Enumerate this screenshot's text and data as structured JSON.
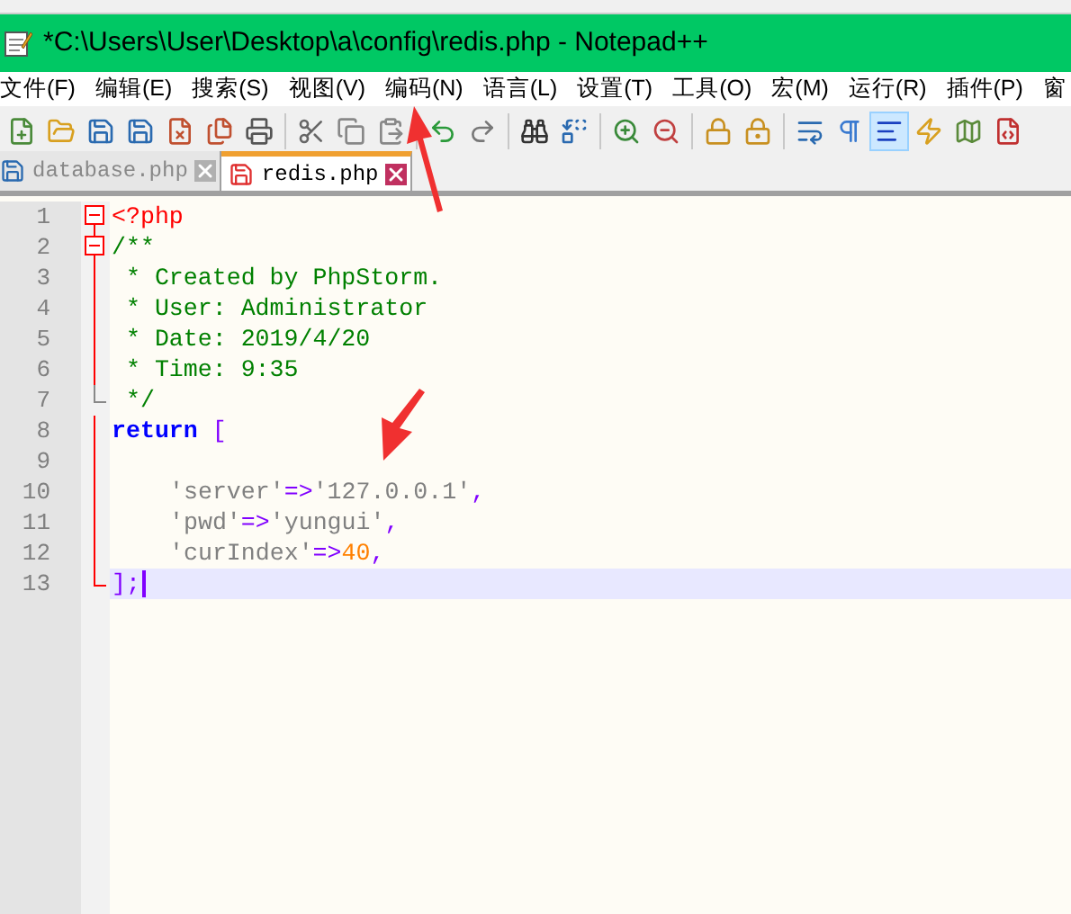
{
  "window": {
    "title": "*C:\\Users\\User\\Desktop\\a\\config\\redis.php - Notepad++"
  },
  "menu": [
    "文件(F)",
    "编辑(E)",
    "搜索(S)",
    "视图(V)",
    "编码(N)",
    "语言(L)",
    "设置(T)",
    "工具(O)",
    "宏(M)",
    "运行(R)",
    "插件(P)",
    "窗"
  ],
  "toolbar": [
    {
      "kind": "button",
      "selected": false
    },
    {
      "kind": "button",
      "selected": false
    },
    {
      "kind": "button",
      "selected": false
    },
    {
      "kind": "button",
      "selected": false
    },
    {
      "kind": "button",
      "selected": false
    },
    {
      "kind": "button",
      "selected": false
    },
    {
      "kind": "button",
      "selected": false
    },
    {
      "kind": "separator"
    },
    {
      "kind": "button",
      "selected": false
    },
    {
      "kind": "button",
      "selected": false
    },
    {
      "kind": "button",
      "selected": false
    },
    {
      "kind": "separator"
    },
    {
      "kind": "button",
      "selected": false
    },
    {
      "kind": "button",
      "selected": false
    },
    {
      "kind": "separator"
    },
    {
      "kind": "button",
      "selected": false
    },
    {
      "kind": "button",
      "selected": false
    },
    {
      "kind": "separator"
    },
    {
      "kind": "button",
      "selected": false
    },
    {
      "kind": "button",
      "selected": false
    },
    {
      "kind": "separator"
    },
    {
      "kind": "button",
      "selected": false
    },
    {
      "kind": "button",
      "selected": false
    },
    {
      "kind": "separator"
    },
    {
      "kind": "button",
      "selected": false
    },
    {
      "kind": "button",
      "selected": false
    },
    {
      "kind": "button",
      "selected": true
    },
    {
      "kind": "button",
      "selected": false
    },
    {
      "kind": "button",
      "selected": false
    },
    {
      "kind": "button",
      "selected": false
    }
  ],
  "tabs": [
    {
      "label": "database.php",
      "selected": false,
      "modified": false
    },
    {
      "label": "redis.php",
      "selected": true,
      "modified": true
    }
  ],
  "lines": [
    {
      "number": "1",
      "fold_start": true,
      "fold_end": false,
      "indented": false,
      "current": false,
      "tokens": [
        {
          "kind": "tag",
          "text": "<?php"
        }
      ]
    },
    {
      "number": "2",
      "fold_start": true,
      "fold_end": false,
      "indented": false,
      "current": false,
      "tokens": [
        {
          "kind": "comment",
          "text": "/**"
        }
      ]
    },
    {
      "number": "3",
      "fold_start": false,
      "fold_end": false,
      "indented": false,
      "current": false,
      "tokens": [
        {
          "kind": "comment",
          "text": " * Created by PhpStorm."
        }
      ]
    },
    {
      "number": "4",
      "fold_start": false,
      "fold_end": false,
      "indented": false,
      "current": false,
      "tokens": [
        {
          "kind": "comment",
          "text": " * User: Administrator"
        }
      ]
    },
    {
      "number": "5",
      "fold_start": false,
      "fold_end": false,
      "indented": false,
      "current": false,
      "tokens": [
        {
          "kind": "comment",
          "text": " * Date: 2019/4/20"
        }
      ]
    },
    {
      "number": "6",
      "fold_start": false,
      "fold_end": false,
      "indented": false,
      "current": false,
      "tokens": [
        {
          "kind": "comment",
          "text": " * Time: 9:35"
        }
      ]
    },
    {
      "number": "7",
      "fold_start": false,
      "fold_end": true,
      "indented": false,
      "current": false,
      "tokens": [
        {
          "kind": "comment",
          "text": " */"
        }
      ]
    },
    {
      "number": "8",
      "fold_start": false,
      "fold_end": false,
      "indented": false,
      "current": false,
      "tokens": [
        {
          "kind": "keyword",
          "text": "return"
        },
        {
          "kind": "operator",
          "text": "["
        }
      ]
    },
    {
      "number": "9",
      "fold_start": false,
      "fold_end": false,
      "current": false
    },
    {
      "number": "10",
      "fold_start": false,
      "fold_end": false,
      "indented": true,
      "current": false,
      "tokens": [
        {
          "kind": "string",
          "text": "'server'"
        },
        {
          "kind": "operator",
          "text": "=>"
        },
        {
          "kind": "string",
          "text": "'127.0.0.1'"
        },
        {
          "kind": "operator",
          "text": ","
        }
      ]
    },
    {
      "number": "11",
      "fold_start": false,
      "fold_end": false,
      "indented": true,
      "current": false,
      "tokens": [
        {
          "kind": "string",
          "text": "'pwd'"
        },
        {
          "kind": "operator",
          "text": "=>"
        },
        {
          "kind": "string",
          "text": "'yungui'"
        },
        {
          "kind": "operator",
          "text": ","
        }
      ]
    },
    {
      "number": "12",
      "fold_start": false,
      "fold_end": false,
      "indented": true,
      "current": false,
      "tokens": [
        {
          "kind": "string",
          "text": "'curIndex'"
        },
        {
          "kind": "operator",
          "text": "=>"
        },
        {
          "kind": "number",
          "text": "40"
        },
        {
          "kind": "operator",
          "text": ","
        }
      ]
    },
    {
      "number": "13",
      "fold_start": false,
      "fold_end": true,
      "indented": false,
      "current": true,
      "tokens": [
        {
          "kind": "operator",
          "text": "];"
        }
      ]
    }
  ]
}
